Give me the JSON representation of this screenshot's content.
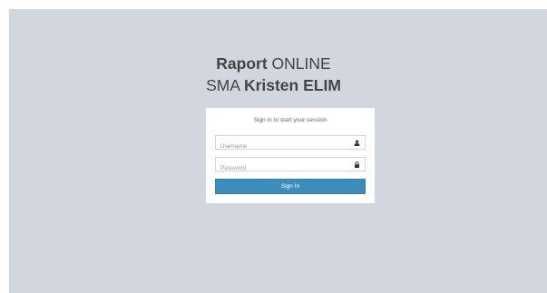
{
  "logo": {
    "line1_bold": "Raport",
    "line1_rest": "ONLINE",
    "line2_start": "SMA",
    "line2_bold": "Kristen ELIM"
  },
  "login": {
    "message": "Sign in to start your session",
    "username_placeholder": "Username",
    "password_placeholder": "Password",
    "signin_label": "Sign In",
    "username_icon": "user-icon",
    "password_icon": "lock-icon"
  },
  "colors": {
    "background": "#d2d6de",
    "primary_button": "#3c8dbc"
  }
}
